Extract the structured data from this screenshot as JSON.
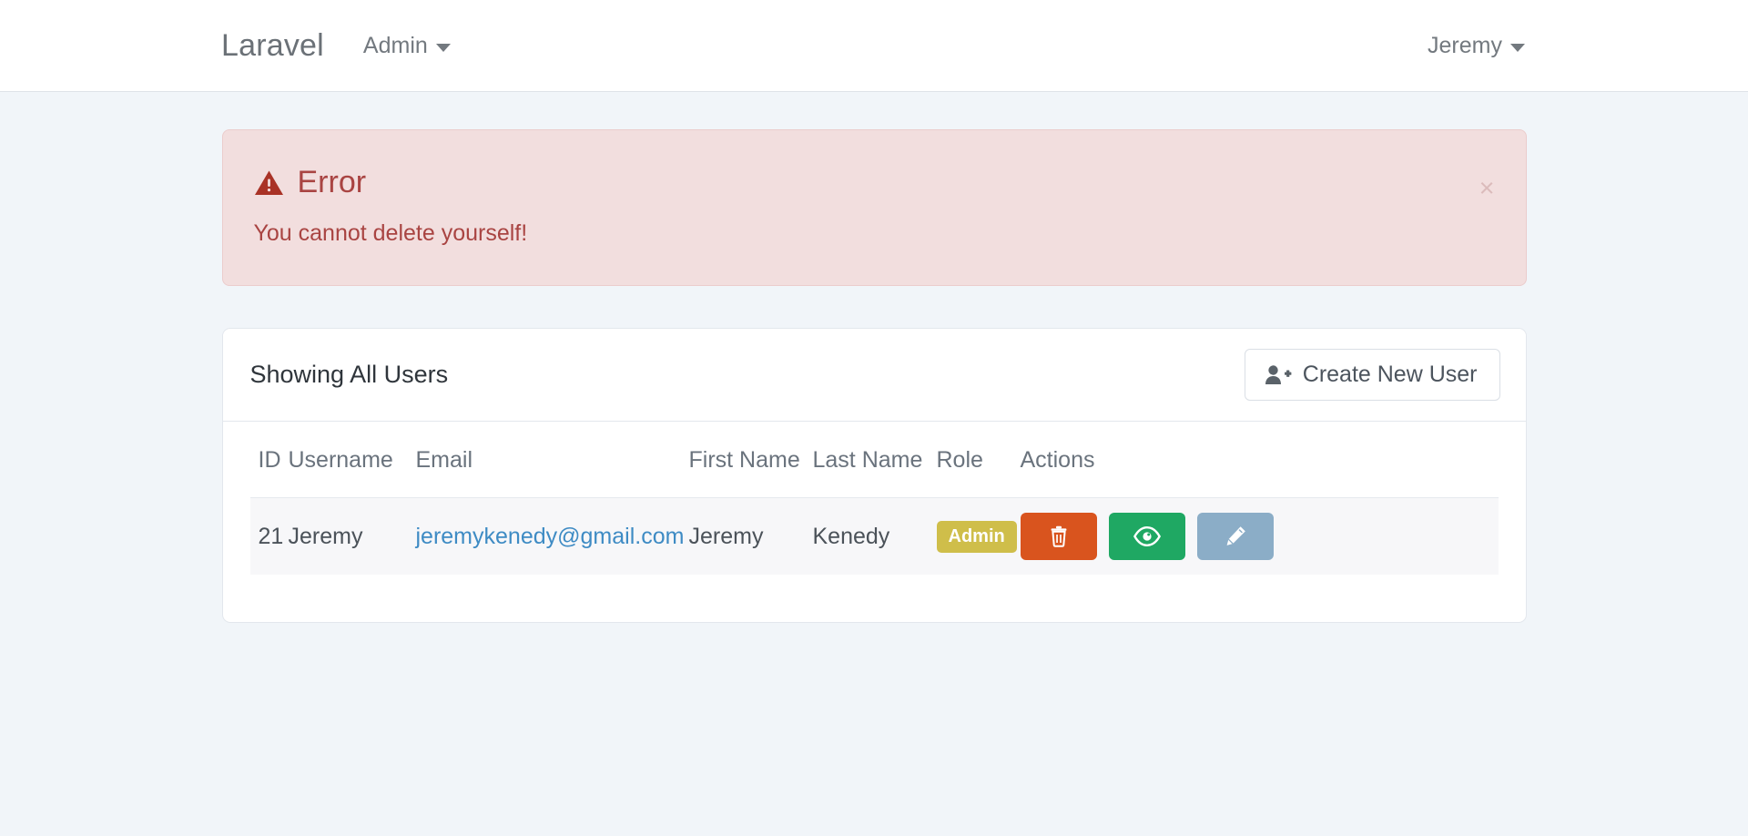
{
  "navbar": {
    "brand": "Laravel",
    "items": [
      {
        "label": "Admin",
        "icon": "chevron-down-icon"
      }
    ],
    "user": {
      "label": "Jeremy",
      "icon": "chevron-down-icon"
    }
  },
  "alert": {
    "icon": "warning-triangle-icon",
    "heading": "Error",
    "message": "You cannot delete yourself!",
    "close_label": "×",
    "bg_color": "#f2dede",
    "border_color": "#ebcccc",
    "text_color": "#a94442"
  },
  "card": {
    "title": "Showing All Users",
    "create_button": {
      "label": "Create New User",
      "icon": "user-plus-icon"
    }
  },
  "table": {
    "columns": [
      "ID",
      "Username",
      "Email",
      "First Name",
      "Last Name",
      "Role",
      "Actions"
    ],
    "rows": [
      {
        "id": "21",
        "username": "Jeremy",
        "email": "jeremykenedy@gmail.com",
        "first_name": "Jeremy",
        "last_name": "Kenedy",
        "role": "Admin",
        "role_color": "#cfbe4a",
        "actions": [
          {
            "name": "delete",
            "icon": "trash-icon",
            "color": "#d9541e"
          },
          {
            "name": "view",
            "icon": "eye-icon",
            "color": "#1fa863"
          },
          {
            "name": "edit",
            "icon": "pencil-icon",
            "color": "#8badc7"
          }
        ]
      }
    ]
  },
  "theme": {
    "page_background": "#f1f5f9",
    "navbar_background": "#ffffff",
    "link_color": "#3e8bc4"
  }
}
